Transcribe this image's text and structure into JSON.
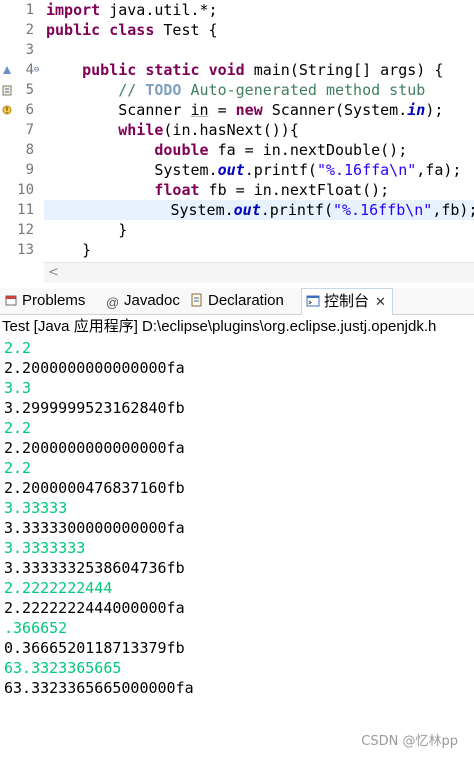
{
  "editor": {
    "line_numbers": [
      "1",
      "2",
      "3",
      "4",
      "5",
      "6",
      "7",
      "8",
      "9",
      "10",
      "11",
      "12",
      "13"
    ],
    "lines": {
      "l1": {
        "kw": "import",
        "rest": " java.util.*;"
      },
      "l2": {
        "kw1": "public",
        "kw2": "class",
        "rest": " Test {"
      },
      "l4": {
        "kw1": "public",
        "kw2": "static",
        "kw3": "void",
        "rest": " main(String[] args) {"
      },
      "l5": {
        "slashes": "// ",
        "todo": "TODO",
        "rest": " Auto-generated method stub"
      },
      "l6": {
        "a": "Scanner ",
        "var": "in",
        "b": " = ",
        "kw": "new",
        "c": " Scanner(System.",
        "fld": "in",
        "d": ");"
      },
      "l7": {
        "kw": "while",
        "rest": "(in.hasNext()){"
      },
      "l8": {
        "kw": "double",
        "rest": " fa = in.nextDouble();"
      },
      "l9": {
        "a": "System.",
        "fld": "out",
        "b": ".printf(",
        "str": "\"%.16ffa\\n\"",
        "c": ",fa);"
      },
      "l10": {
        "kw": "float",
        "rest": " fb = in.nextFloat();"
      },
      "l11": {
        "a": "System.",
        "fld": "out",
        "b": ".printf(",
        "str": "\"%.16ffb\\n\"",
        "c": ",fb);"
      },
      "l12": {
        "text": "}"
      },
      "l13": {
        "text": "}"
      }
    },
    "scroll_left": "<"
  },
  "tabs": {
    "problems": "Problems",
    "javadoc": "Javadoc",
    "declaration": "Declaration",
    "console": "控制台",
    "close": "✕"
  },
  "console": {
    "title": "Test [Java 应用程序] D:\\eclipse\\plugins\\org.eclipse.justj.openjdk.h",
    "lines": [
      {
        "type": "in",
        "text": "2.2"
      },
      {
        "type": "out",
        "text": "2.2000000000000000fa"
      },
      {
        "type": "in",
        "text": "3.3"
      },
      {
        "type": "out",
        "text": "3.2999999523162840fb"
      },
      {
        "type": "in",
        "text": "2.2"
      },
      {
        "type": "out",
        "text": "2.2000000000000000fa"
      },
      {
        "type": "in",
        "text": "2.2"
      },
      {
        "type": "out",
        "text": "2.2000000476837160fb"
      },
      {
        "type": "in",
        "text": "3.33333"
      },
      {
        "type": "out",
        "text": "3.3333300000000000fa"
      },
      {
        "type": "in",
        "text": "3.3333333"
      },
      {
        "type": "out",
        "text": "3.3333332538604736fb"
      },
      {
        "type": "in",
        "text": "2.2222222444"
      },
      {
        "type": "out",
        "text": "2.2222222444000000fa"
      },
      {
        "type": "in",
        "text": ".366652"
      },
      {
        "type": "out",
        "text": "0.3666520118713379fb"
      },
      {
        "type": "in",
        "text": "63.3323365665"
      },
      {
        "type": "out",
        "text": "63.3323365665000000fa"
      }
    ]
  },
  "watermark": "CSDN @忆林pp",
  "colors": {
    "keyword": "#7f0055",
    "comment": "#3f7f5f",
    "string": "#2a00ff",
    "field": "#0000c0",
    "console_input": "#00c87d",
    "current_line": "#e8f2fe"
  }
}
